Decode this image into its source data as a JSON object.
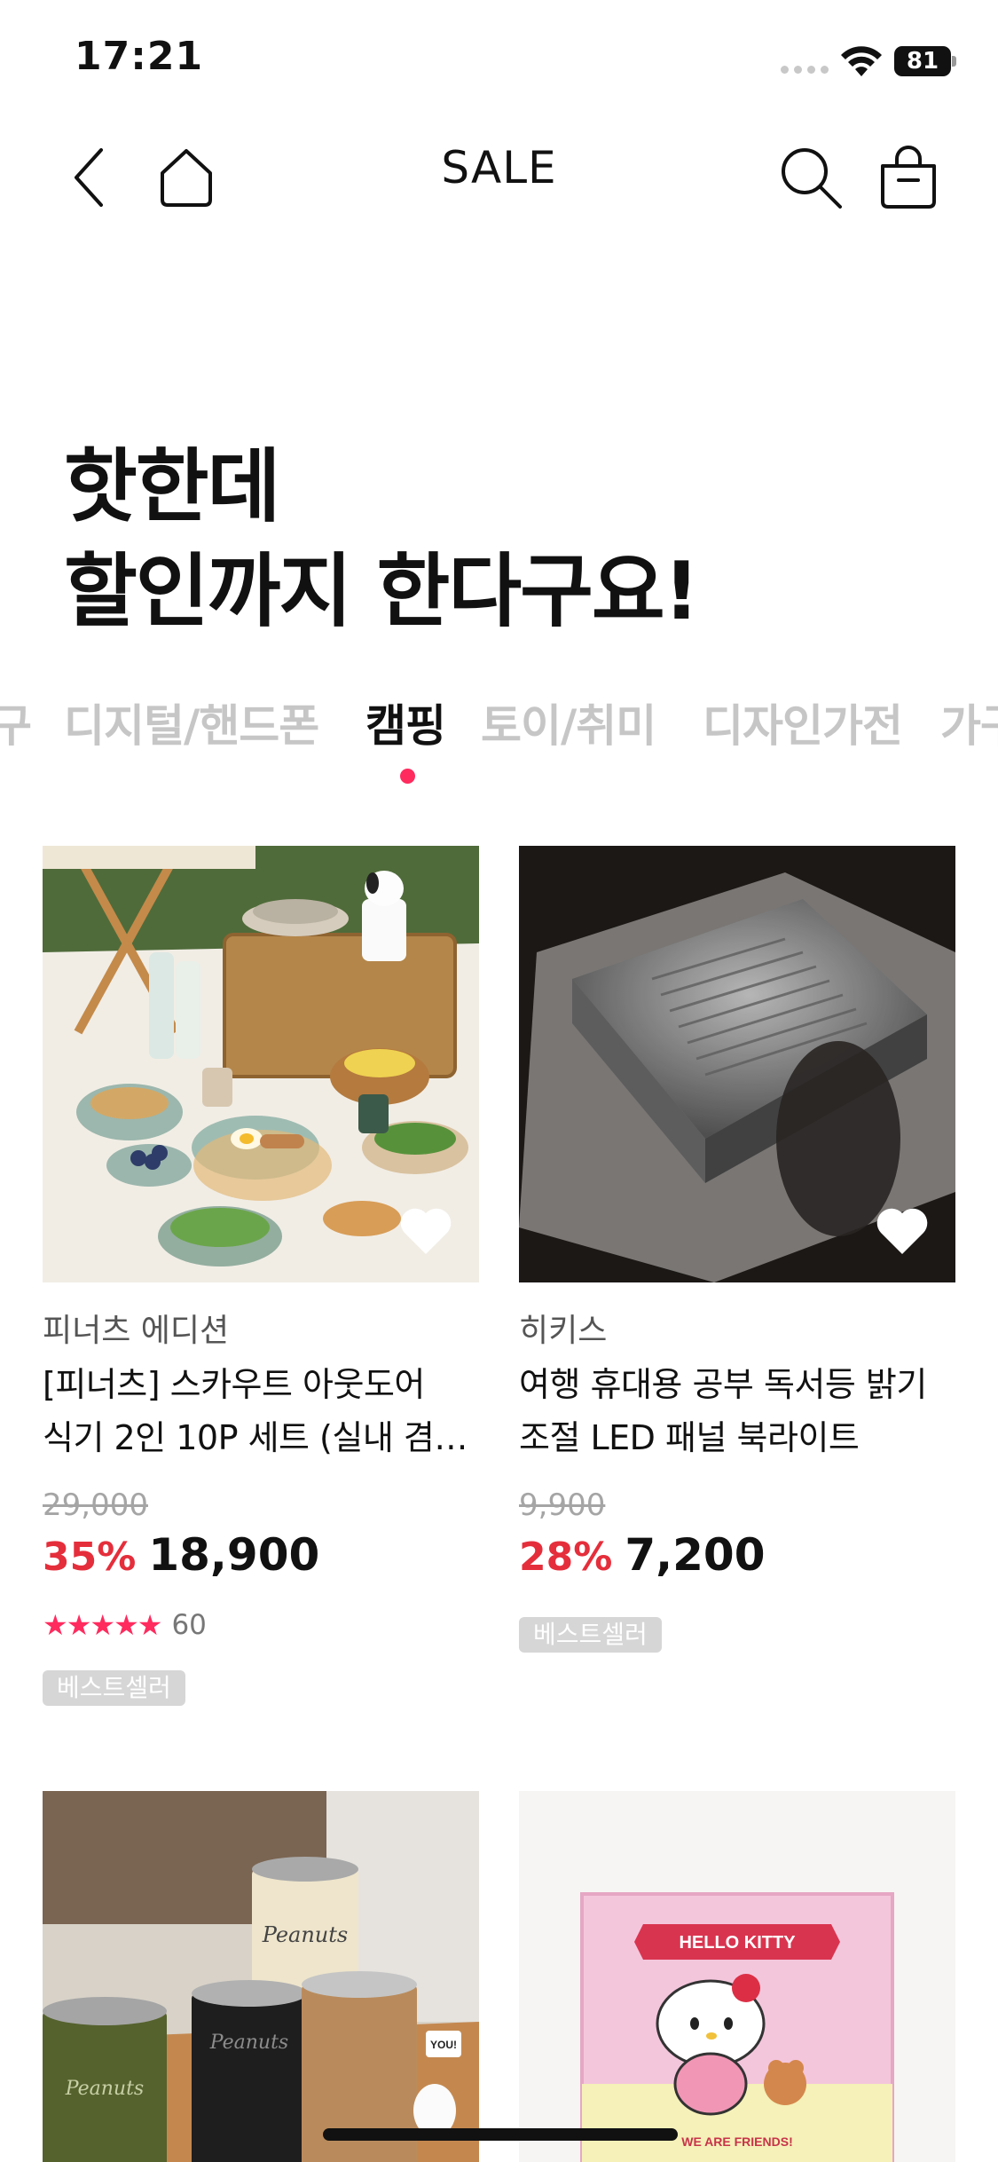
{
  "status_bar": {
    "time": "17:21",
    "battery": "81"
  },
  "nav": {
    "title": "SALE"
  },
  "headline": {
    "line1": "핫한데",
    "line2": "할인까지 한다구요!"
  },
  "tabs": [
    "구",
    "디지털/핸드폰",
    "캠핑",
    "토이/취미",
    "디자인가전",
    "가구"
  ],
  "active_tab": "캠핑",
  "products": [
    {
      "brand": "피너츠 에디션",
      "title_line1": "[피너츠] 스카우트 아웃도어",
      "title_line2": "식기 2인 10P 세트 (실내 겸…",
      "original_price": "29,000",
      "discount": "35%",
      "price": "18,900",
      "stars": "★★★★★",
      "review_count": "60",
      "badge": "베스트셀러"
    },
    {
      "brand": "히키스",
      "title_line1": "여행 휴대용 공부 독서등 밝기",
      "title_line2": "조절 LED 패널 북라이트",
      "original_price": "9,900",
      "discount": "28%",
      "price": "7,200",
      "badge": "베스트셀러"
    },
    {
      "image_text": "Peanuts",
      "image_text2": "YOU!"
    },
    {
      "image_text": "HELLO KITTY",
      "image_text2": "WE ARE FRIENDS!"
    }
  ]
}
